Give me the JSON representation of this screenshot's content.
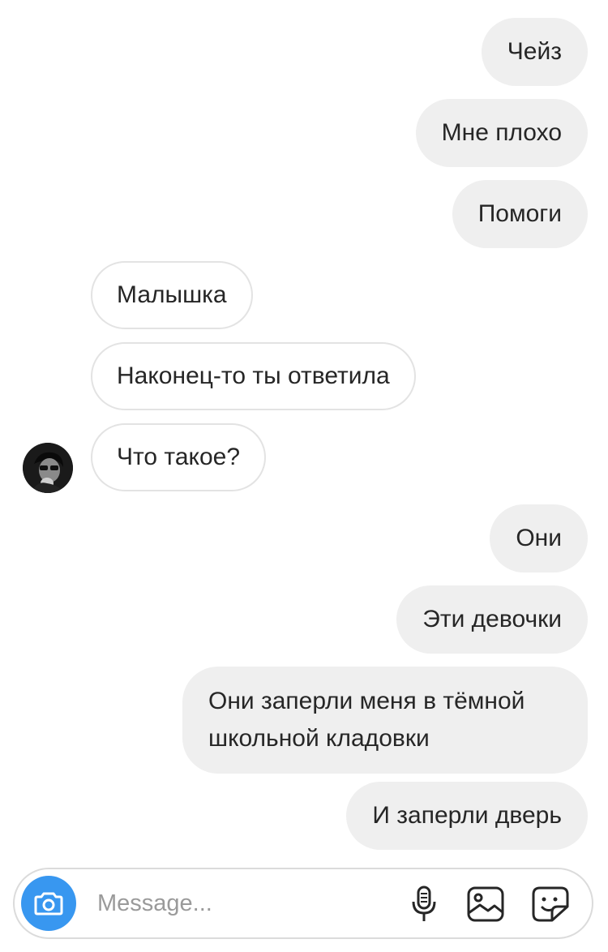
{
  "messages": [
    {
      "direction": "outgoing",
      "text": "Чейз"
    },
    {
      "direction": "outgoing",
      "text": "Мне плохо"
    },
    {
      "direction": "outgoing",
      "text": "Помоги"
    },
    {
      "direction": "incoming",
      "text": "Малышка"
    },
    {
      "direction": "incoming",
      "text": "Наконец-то ты ответила"
    },
    {
      "direction": "incoming",
      "text": "Что такое?"
    },
    {
      "direction": "outgoing",
      "text": "Они"
    },
    {
      "direction": "outgoing",
      "text": "Эти девочки"
    },
    {
      "direction": "outgoing",
      "text": "Они заперли меня в тёмной школьной кладовки"
    },
    {
      "direction": "outgoing",
      "text": "И заперли дверь"
    }
  ],
  "composer": {
    "placeholder": "Message...",
    "value": "",
    "icons": [
      "camera-icon",
      "microphone-icon",
      "gallery-icon",
      "sticker-icon"
    ]
  },
  "colors": {
    "outgoing_bubble": "#efefef",
    "incoming_border": "#e3e3e3",
    "camera_button": "#3897f0",
    "text": "#262626",
    "placeholder": "#9a9a9a"
  }
}
